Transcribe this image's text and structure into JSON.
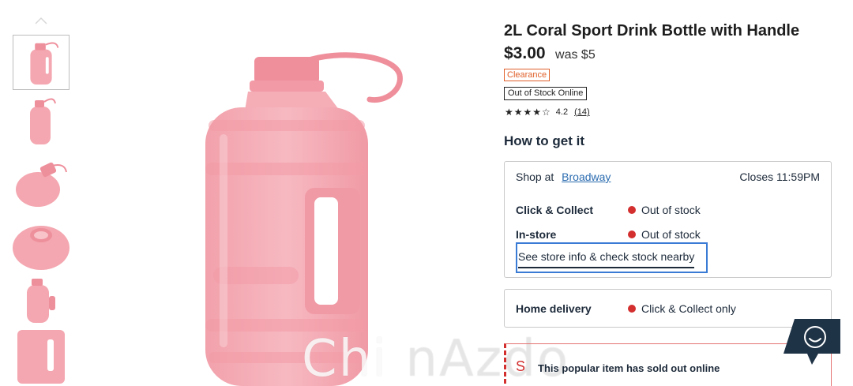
{
  "product": {
    "title": "2L Coral Sport Drink Bottle with Handle",
    "price": "$3.00",
    "was_price": "was $5",
    "badge_clearance": "Clearance",
    "badge_stock": "Out of Stock Online",
    "rating": {
      "stars_display": "★★★★☆",
      "value": "4.2",
      "count": "(14)",
      "stars_filled": 4,
      "stars_total": 5
    }
  },
  "how_to_get_it": {
    "heading": "How to get it",
    "store": {
      "shop_at_label": "Shop at",
      "store_name": "Broadway",
      "closes": "Closes 11:59PM",
      "click_collect_label": "Click & Collect",
      "click_collect_status": "Out of stock",
      "instore_label": "In-store",
      "instore_status": "Out of stock",
      "see_store_link": "See store info & check stock nearby"
    },
    "delivery": {
      "label": "Home delivery",
      "status": "Click & Collect only"
    },
    "sold_out_notice": "This popular item has sold out online"
  },
  "watermark": {
    "text_solid": "Chi",
    "text_faint": " nAzdo"
  },
  "icons": {
    "thumb_scroll_up": "chevron-up-icon",
    "status_dot": "status-dot-icon",
    "sold_out_icon": "alert-icon",
    "chat": "chat-smiley-icon"
  },
  "colors": {
    "bottle": "#f4a7b0",
    "status_red": "#d32f2f",
    "clearance": "#e0602a",
    "link_blue": "#2b6cb0",
    "chat_navy": "#1f3346"
  }
}
